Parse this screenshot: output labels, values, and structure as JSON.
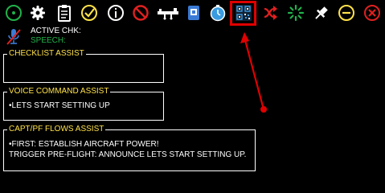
{
  "toolbar": {
    "icons": [
      {
        "name": "power-icon",
        "color": "#21b24b"
      },
      {
        "name": "gear-icon",
        "color": "#ffffff"
      },
      {
        "name": "clipboard-icon",
        "color": "#ffffff"
      },
      {
        "name": "checkmark-circle-icon",
        "color": "#ffe24a"
      },
      {
        "name": "info-icon",
        "color": "#ffffff"
      },
      {
        "name": "prohibited-icon",
        "color": "#e02020"
      },
      {
        "name": "aircraft-icon",
        "color": "#ffffff"
      },
      {
        "name": "document-badge-icon",
        "color": "#3a7bd5"
      },
      {
        "name": "clock-icon",
        "color": "#3a9be0"
      },
      {
        "name": "qr-code-icon",
        "color": "#3a9be0"
      },
      {
        "name": "shuffle-icon",
        "color": "#e02020"
      },
      {
        "name": "loading-spinner-icon",
        "color": "#21b24b"
      },
      {
        "name": "pin-icon",
        "color": "#ffffff"
      },
      {
        "name": "minimize-icon",
        "color": "#ffe24a"
      },
      {
        "name": "close-icon",
        "color": "#e02020"
      }
    ],
    "highlighted_icon": "qr-code-icon"
  },
  "status": {
    "active_chk_label": "ACTIVE CHK:",
    "speech_label": "SPEECH:",
    "mic_icon": "microphone-muted-icon"
  },
  "panels": {
    "checklist_assist": {
      "title": "CHECKLIST ASSIST",
      "lines": []
    },
    "voice_command_assist": {
      "title": "VOICE COMMAND ASSIST",
      "lines": [
        "•LETS START SETTING UP"
      ]
    },
    "capt_pf_flows_assist": {
      "title": "CAPT/PF FLOWS ASSIST",
      "lines": [
        "•FIRST: ESTABLISH AIRCRAFT POWER!",
        "TRIGGER PRE-FLIGHT: ANNOUNCE LETS START SETTING UP."
      ]
    }
  },
  "annotation": {
    "color": "#e00000"
  }
}
